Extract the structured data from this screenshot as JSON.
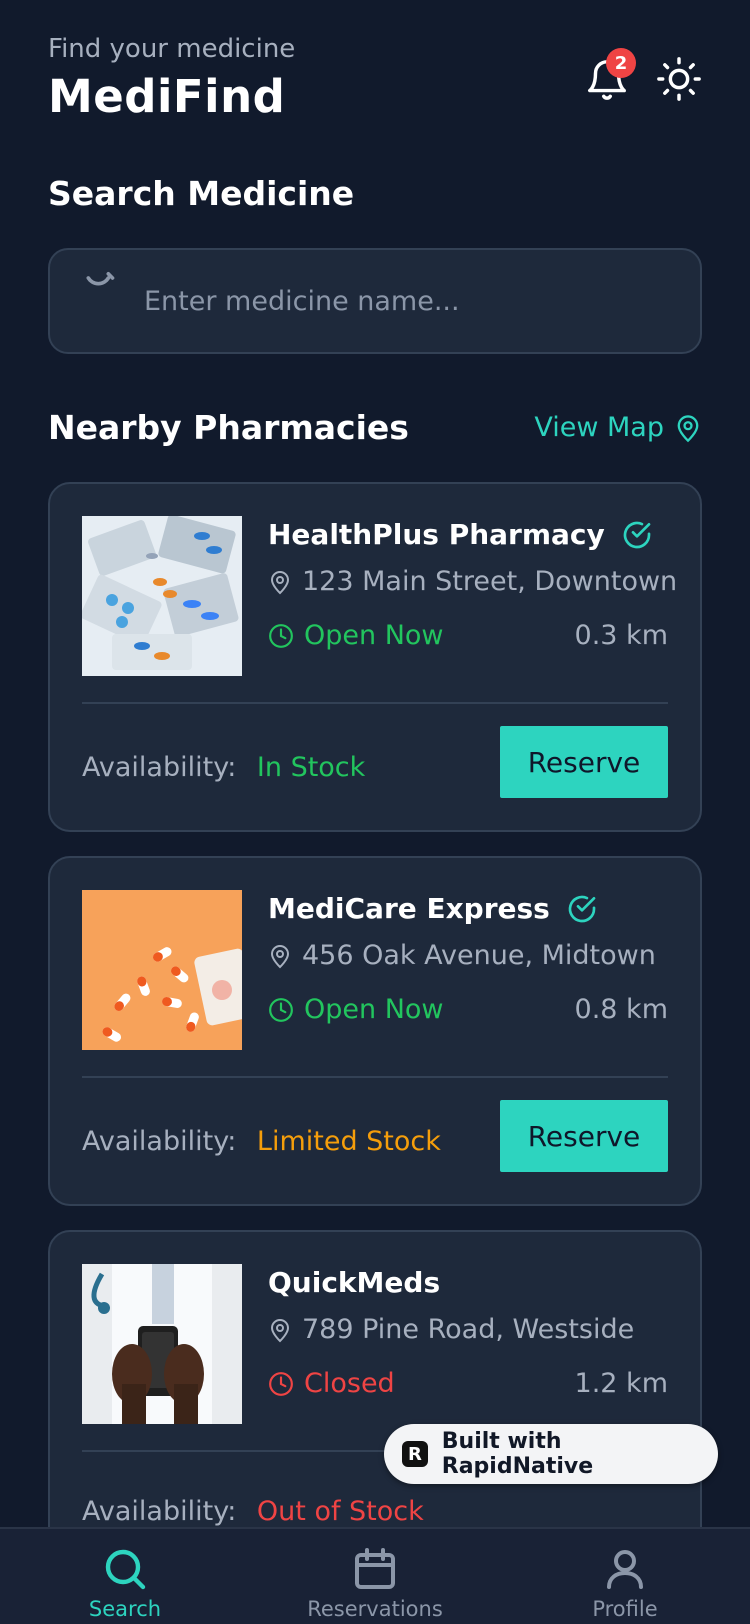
{
  "header": {
    "subtitle": "Find your medicine",
    "title": "MediFind",
    "notification_count": "2"
  },
  "search": {
    "section_title": "Search Medicine",
    "placeholder": "Enter medicine name..."
  },
  "nearby": {
    "section_title": "Nearby Pharmacies",
    "view_map_label": "View Map"
  },
  "availability_label": "Availability:",
  "reserve_label": "Reserve",
  "pharmacies": [
    {
      "name": "HealthPlus Pharmacy",
      "verified": true,
      "address": "123 Main Street, Downtown",
      "status": "Open Now",
      "distance": "0.3 km",
      "availability": "In Stock"
    },
    {
      "name": "MediCare Express",
      "verified": true,
      "address": "456 Oak Avenue, Midtown",
      "status": "Open Now",
      "distance": "0.8 km",
      "availability": "Limited Stock"
    },
    {
      "name": "QuickMeds",
      "verified": false,
      "address": "789 Pine Road, Westside",
      "status": "Closed",
      "distance": "1.2 km",
      "availability": "Out of Stock"
    }
  ],
  "branding": {
    "built_with": "Built with RapidNative"
  },
  "nav": {
    "search": "Search",
    "reservations": "Reservations",
    "profile": "Profile"
  },
  "colors": {
    "accent": "#2dd4bf",
    "open": "#22c55e",
    "limited": "#f59e0b",
    "closed": "#ef4444",
    "background": "#111a2c",
    "card": "#1e293b"
  }
}
